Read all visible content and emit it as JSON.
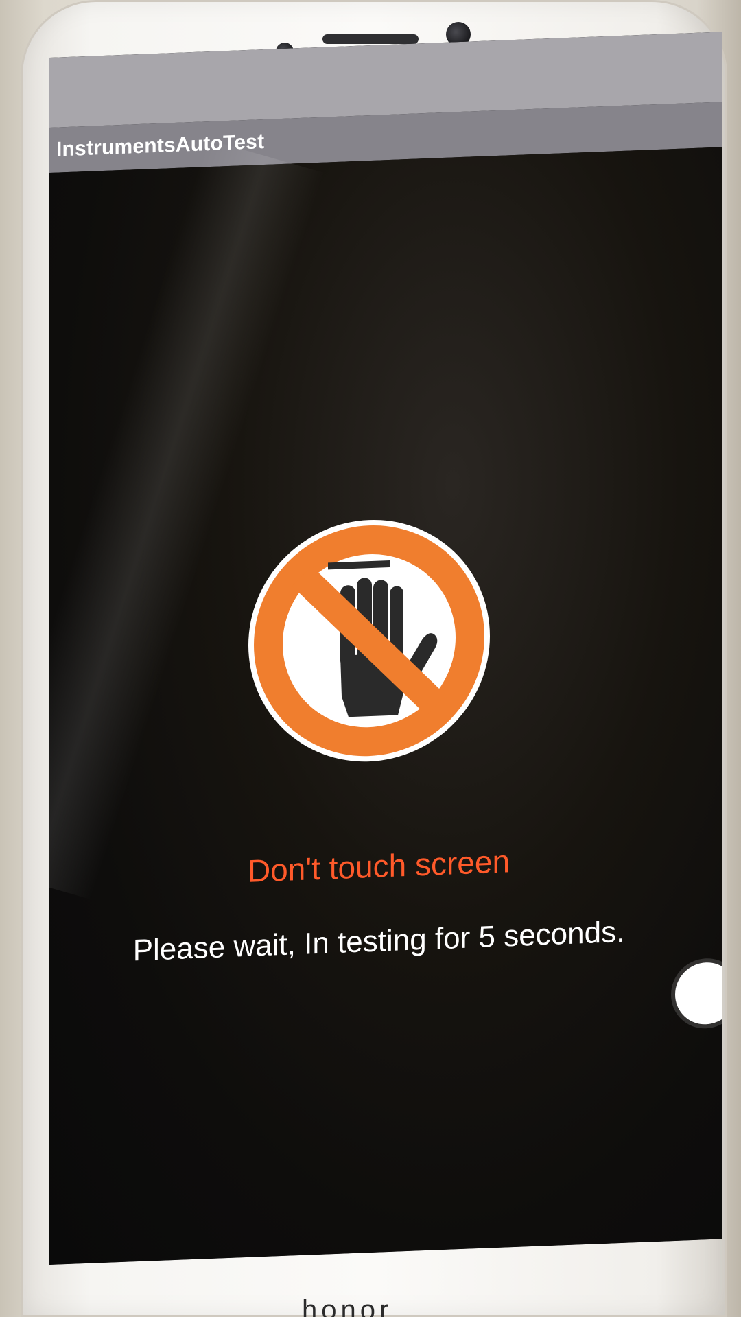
{
  "app": {
    "title": "InstrumentsAutoTest"
  },
  "main": {
    "icon": "no-touch-icon",
    "warning_text": "Don't touch screen",
    "info_text": "Please wait, In testing for 5 seconds."
  },
  "overlay": {
    "assistive_touch_icon": "circle"
  },
  "device": {
    "brand_logo": "honor"
  },
  "colors": {
    "warning": "#ff5a2a",
    "prohibition": "#f07e2e",
    "title_bar": "#86848b",
    "background": "#101010"
  }
}
